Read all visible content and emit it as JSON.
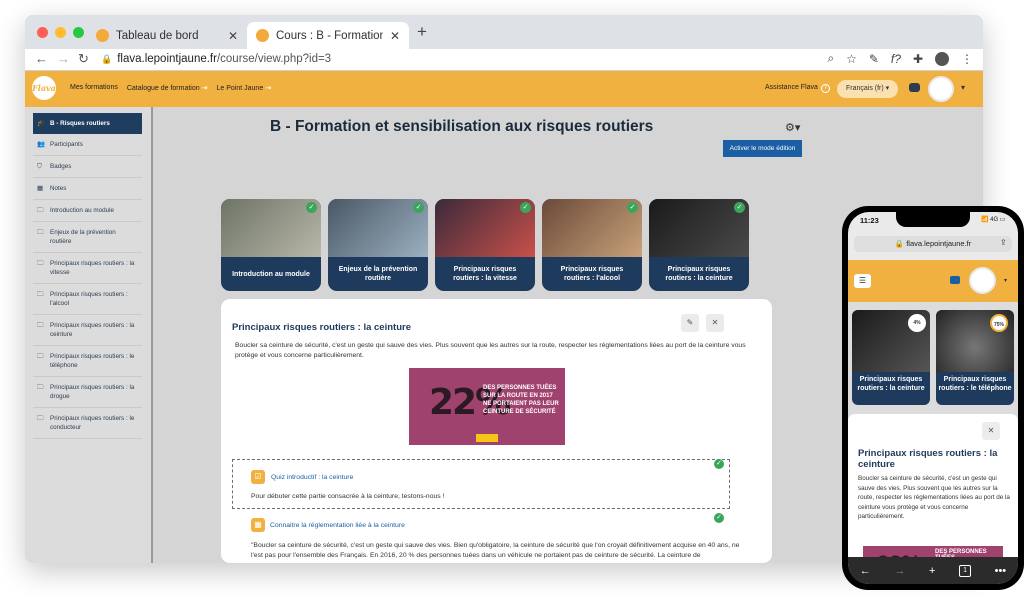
{
  "browser": {
    "tabs": [
      {
        "title": "Tableau de bord",
        "close": "✕"
      },
      {
        "title": "Cours : B - Formation et sensibilisation",
        "close": "✕"
      }
    ],
    "new_tab": "+",
    "url_host": "flava.lepointjaune.fr",
    "url_path": "/course/view.php?id=3"
  },
  "appbar": {
    "logo_text": "Flava",
    "nav": [
      "Mes formations",
      "Catalogue de formation",
      "Le Point Jaune"
    ],
    "assistance": "Assistance Flava",
    "language": "Français (fr) ▾"
  },
  "sidebar": {
    "items": [
      {
        "label": "B - Risques routiers",
        "icon": "🎓"
      },
      {
        "label": "Participants",
        "icon": "👥"
      },
      {
        "label": "Badges",
        "icon": "⛉"
      },
      {
        "label": "Notes",
        "icon": "▦"
      },
      {
        "label": "Introduction au module",
        "icon": "🗀"
      },
      {
        "label": "Enjeux de la prévention routière",
        "icon": "🗀"
      },
      {
        "label": "Principaux risques routiers : la vitesse",
        "icon": "🗀"
      },
      {
        "label": "Principaux risques routiers : l'alcool",
        "icon": "🗀"
      },
      {
        "label": "Principaux risques routiers : la ceinture",
        "icon": "🗀"
      },
      {
        "label": "Principaux risques routiers : le téléphone",
        "icon": "🗀"
      },
      {
        "label": "Principaux risques routiers : la drogue",
        "icon": "🗀"
      },
      {
        "label": "Principaux risques routiers : le conducteur",
        "icon": "🗀"
      }
    ]
  },
  "course": {
    "title": "B - Formation et sensibilisation aux risques routiers",
    "edit_mode_button": "Activer le mode édition",
    "tiles": [
      {
        "label": "Introduction au module",
        "bg1": "#6d7466",
        "bg2": "#b9b7a8"
      },
      {
        "label": "Enjeux de la prévention routière",
        "bg1": "#4a5866",
        "bg2": "#9bb0c0"
      },
      {
        "label": "Principaux risques routiers : la vitesse",
        "bg1": "#3b2a3a",
        "bg2": "#c8504a"
      },
      {
        "label": "Principaux risques routiers : l'alcool",
        "bg1": "#6a4a3a",
        "bg2": "#c9a27a"
      },
      {
        "label": "Principaux risques routiers : la ceinture",
        "bg1": "#1a1a1a",
        "bg2": "#4a4a4a"
      }
    ],
    "section": {
      "title": "Principaux risques routiers : la ceinture",
      "description": "Boucler sa ceinture de sécurité, c'est un geste qui sauve des vies. Plus souvent que les autres sur la route, respecter les réglementations liées au port de la ceinture vous protège et vous concerne particulièrement.",
      "poster_percent": "22%",
      "poster_text": "DES PERSONNES TUÉES SUR LA ROUTE EN 2017 NE PORTAIENT PAS LEUR CEINTURE DE SÉCURITÉ",
      "activities": [
        {
          "title": "Quiz introductif : la ceinture",
          "description": "Pour débuter cette partie consacrée à la ceinture, testons-nous !"
        },
        {
          "title": "Connaitre la réglementation liée à la ceinture",
          "description": "\"Boucler sa ceinture de sécurité, c'est un geste qui sauve des vies. Bien qu'obligatoire, la ceinture de sécurité que l'on croyait définitivement acquise en 40 ans, ne l'est pas pour l'ensemble des Français. En 2016, 20 % des personnes tuées dans un véhicule ne portaient pas de ceinture de sécurité. La ceinture de"
        }
      ]
    }
  },
  "phone": {
    "time": "11:23",
    "status": "📶 4G ▭",
    "url": "🔒 flava.lepointjaune.fr",
    "tiles": [
      {
        "label": "Principaux risques routiers : la ceinture",
        "progress": "4%"
      },
      {
        "label": "Principaux risques routiers : le téléphone",
        "progress": "75%"
      }
    ],
    "section_title": "Principaux risques routiers : la ceinture",
    "section_desc": "Boucler sa ceinture de sécurité, c'est un geste qui sauve des vies. Plus souvent que les autres sur la route, respecter les réglementations liées au port de la ceinture vous protège et vous concerne particulièrement.",
    "poster_percent": "22%",
    "poster_text": "DES PERSONNES TUÉES",
    "bottom": [
      "←",
      "→",
      "+",
      "1",
      "•••"
    ]
  },
  "colors": {
    "accent": "#f1b140",
    "navy": "#1e3a5c",
    "link": "#1a5fa3",
    "check": "#3ba55c",
    "poster": "#a0426e"
  }
}
